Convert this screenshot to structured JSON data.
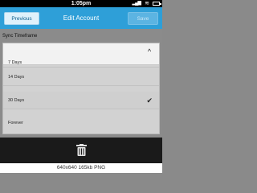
{
  "status_bar": {
    "time": "1:05pm",
    "wifi_icon": "wifi-icon",
    "battery_icon": "battery-icon",
    "signal_icon": "signal-icon"
  },
  "header": {
    "title": "Edit Account",
    "previous_label": "Previous",
    "save_label": "Save",
    "accent_color": "#2e9fd8"
  },
  "form": {
    "section_label": "Sync Timeframe",
    "options": [
      {
        "label": "7 Days",
        "selected": false
      },
      {
        "label": "14 Days",
        "selected": false
      },
      {
        "label": "30 Days",
        "selected": true
      },
      {
        "label": "Forever",
        "selected": false
      }
    ]
  },
  "bottom_bar": {
    "delete_icon": "trash-icon"
  },
  "caption": {
    "text": "640x640  165kb  PNG"
  }
}
